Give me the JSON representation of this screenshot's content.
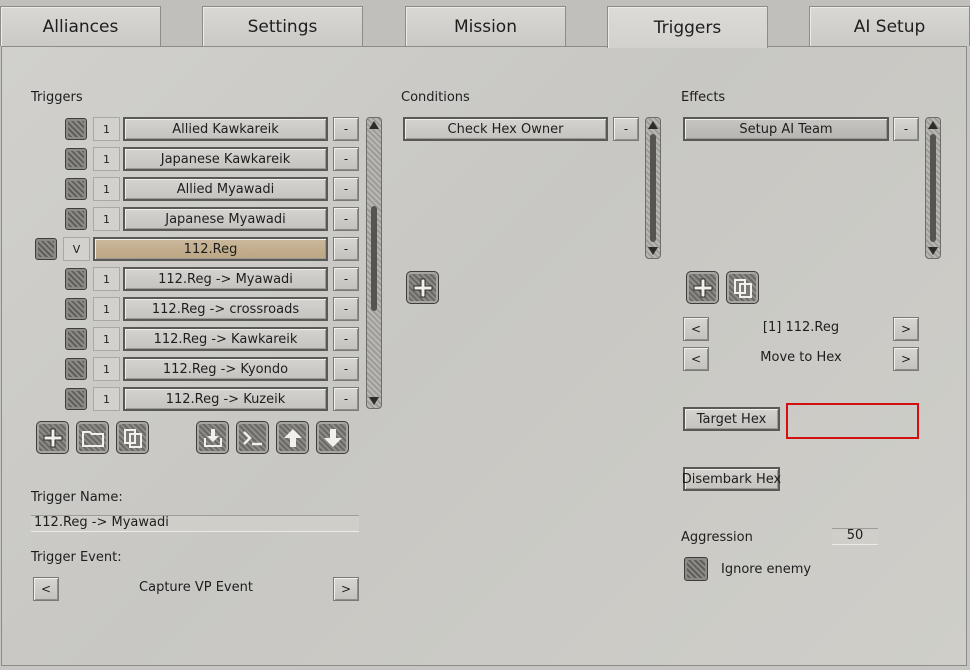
{
  "tabs": [
    {
      "label": "Alliances",
      "active": false
    },
    {
      "label": "Settings",
      "active": false
    },
    {
      "label": "Mission",
      "active": false
    },
    {
      "label": "Triggers",
      "active": true
    },
    {
      "label": "AI Setup",
      "active": false
    }
  ],
  "triggers": {
    "heading": "Triggers",
    "items": [
      {
        "num": "1",
        "label": "Allied Kawkareik",
        "remove": "-"
      },
      {
        "num": "1",
        "label": "Japanese Kawkareik",
        "remove": "-"
      },
      {
        "num": "1",
        "label": "Allied Myawadi",
        "remove": "-"
      },
      {
        "num": "1",
        "label": "Japanese Myawadi",
        "remove": "-"
      },
      {
        "num": "V",
        "label": "112.Reg",
        "remove": "-"
      },
      {
        "num": "1",
        "label": "112.Reg -> Myawadi",
        "remove": "-"
      },
      {
        "num": "1",
        "label": "112.Reg -> crossroads",
        "remove": "-"
      },
      {
        "num": "1",
        "label": "112.Reg -> Kawkareik",
        "remove": "-"
      },
      {
        "num": "1",
        "label": "112.Reg -> Kyondo",
        "remove": "-"
      },
      {
        "num": "1",
        "label": "112.Reg -> Kuzeik",
        "remove": "-"
      }
    ],
    "name_label": "Trigger Name:",
    "name_value": "112.Reg -> Myawadi",
    "event_label": "Trigger Event:",
    "event_value": "Capture VP Event",
    "prev": "<",
    "next": ">"
  },
  "conditions": {
    "heading": "Conditions",
    "items": [
      {
        "label": "Check Hex Owner",
        "remove": "-"
      }
    ]
  },
  "effects": {
    "heading": "Effects",
    "items": [
      {
        "label": "Setup AI Team",
        "remove": "-"
      }
    ],
    "team_value": "[1] 112.Reg",
    "action_value": "Move to Hex",
    "prev": "<",
    "next": ">",
    "target_hex_label": "Target Hex",
    "disembark_hex_label": "Disembark Hex",
    "aggression_label": "Aggression",
    "aggression_value": "50",
    "ignore_enemy_label": "Ignore enemy"
  },
  "colors": {
    "highlight_box": "#d40f0f",
    "selected_row": "#cbb79a"
  }
}
